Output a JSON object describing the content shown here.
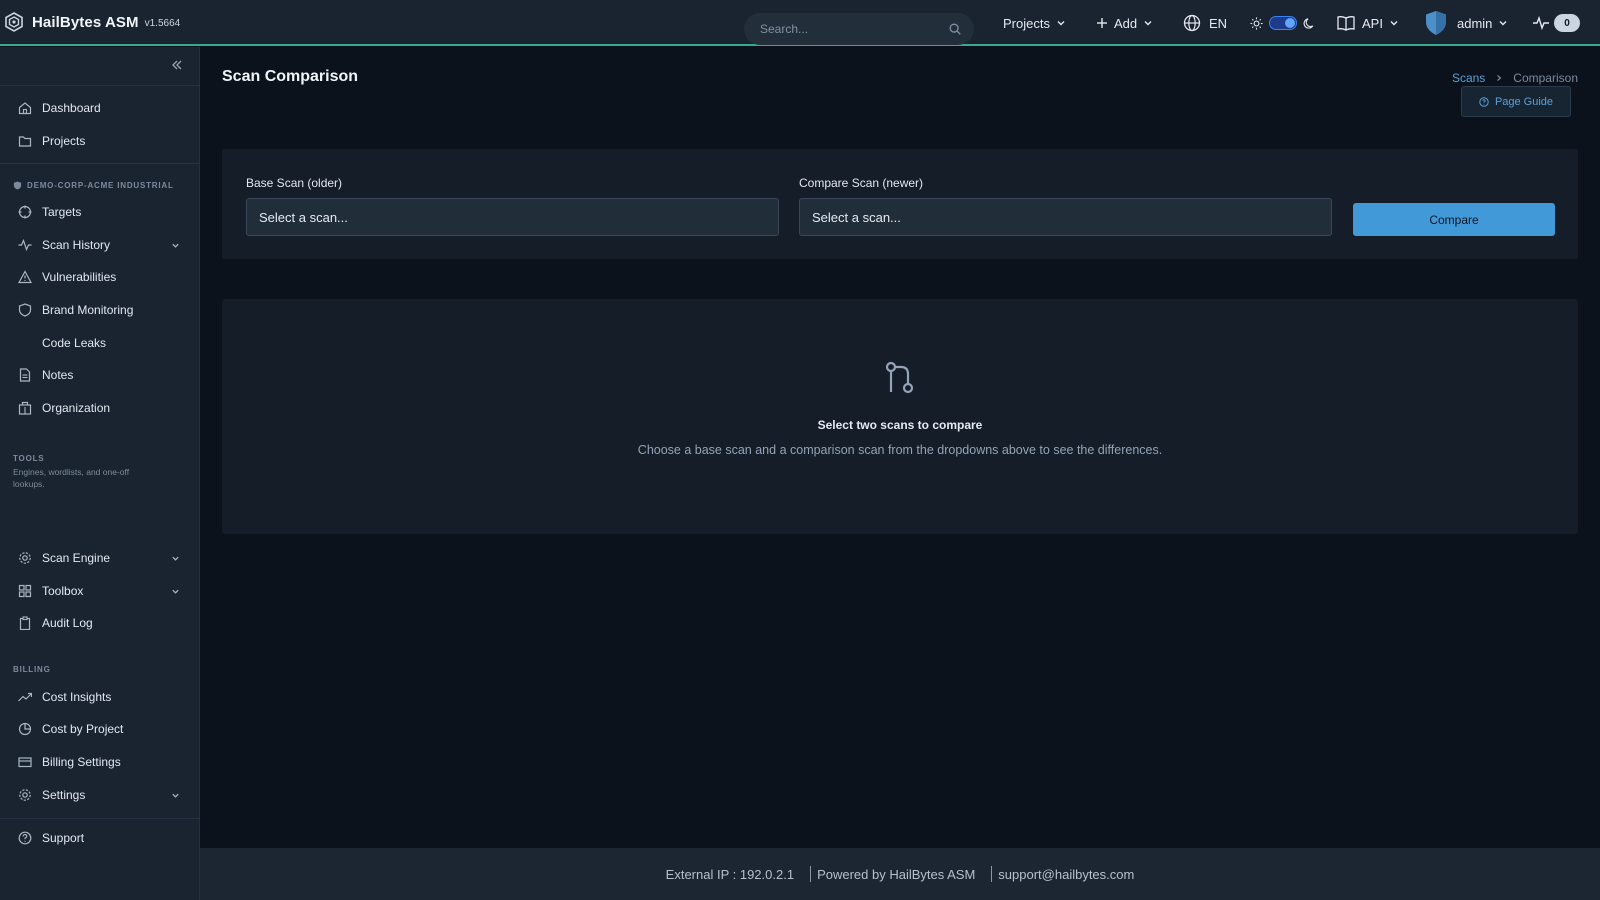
{
  "app": {
    "name": "HailBytes ASM",
    "version": "v1.5664"
  },
  "topbar": {
    "search_placeholder": "Search...",
    "projects_label": "Projects",
    "add_label": "Add",
    "language": "EN",
    "api_label": "API",
    "user": "admin",
    "activity_count": "0",
    "accent_color": "#3aa88f"
  },
  "sidebar": {
    "items_top": [
      {
        "label": "Dashboard",
        "icon": "home-icon"
      },
      {
        "label": "Projects",
        "icon": "folder-icon"
      }
    ],
    "org_section": "DEMO-CORP-ACME INDUSTRIAL",
    "org_items": [
      {
        "label": "Targets",
        "icon": "crosshair-icon"
      },
      {
        "label": "Scan History",
        "icon": "activity-icon"
      },
      {
        "label": "Vulnerabilities",
        "icon": "warning-icon"
      },
      {
        "label": "Brand Monitoring",
        "icon": "shield-icon"
      },
      {
        "label": "Code Leaks",
        "icon": ""
      },
      {
        "label": "Notes",
        "icon": "document-icon"
      },
      {
        "label": "Organization",
        "icon": "building-icon"
      }
    ],
    "tools_section": "TOOLS",
    "tools_desc": "Engines, wordlists, and one-off lookups.",
    "tools_items": [
      {
        "label": "Scan Engine",
        "icon": "gear-icon"
      },
      {
        "label": "Toolbox",
        "icon": "grid-icon"
      },
      {
        "label": "Audit Log",
        "icon": "clipboard-icon"
      }
    ],
    "billing_section": "BILLING",
    "billing_items": [
      {
        "label": "Cost Insights",
        "icon": "trending-icon"
      },
      {
        "label": "Cost by Project",
        "icon": "pie-icon"
      },
      {
        "label": "Billing Settings",
        "icon": "card-icon"
      },
      {
        "label": "Settings",
        "icon": "settings-icon"
      }
    ],
    "support_label": "Support"
  },
  "page": {
    "title": "Scan Comparison",
    "breadcrumb": [
      "Scans",
      "Comparison"
    ],
    "guide_label": "Page Guide"
  },
  "compare_form": {
    "base_label": "Base Scan (older)",
    "base_value": "Select a scan...",
    "compare_label": "Compare Scan (newer)",
    "compare_value": "Select a scan...",
    "button_label": "Compare",
    "button_color": "#4299d8"
  },
  "empty_state": {
    "icon": "git-compare-icon",
    "title": "Select two scans to compare",
    "description": "Choose a base scan and a comparison scan from the dropdowns above to see the differences."
  },
  "footer": {
    "external_ip": "External IP : 192.0.2.1",
    "powered_by": "Powered by HailBytes ASM",
    "support_email": "support@hailbytes.com"
  }
}
